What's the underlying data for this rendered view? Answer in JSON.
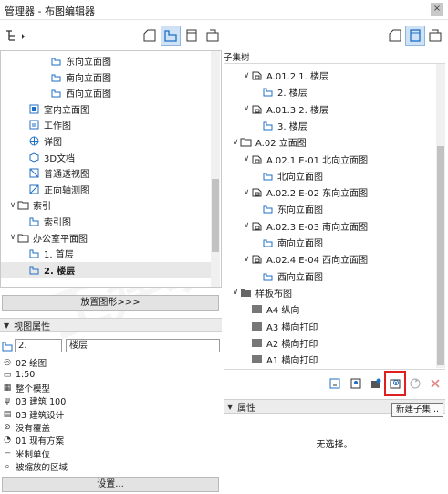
{
  "window": {
    "title": "管理器 - 布图编辑器",
    "close_glyph": "×"
  },
  "left_tree": [
    {
      "label": "东向立面图",
      "icon": "elevation-view-icon",
      "depth": 3,
      "chevron": ""
    },
    {
      "label": "南向立面图",
      "icon": "elevation-view-icon",
      "depth": 3,
      "chevron": ""
    },
    {
      "label": "西向立面图",
      "icon": "elevation-view-icon",
      "depth": 3,
      "chevron": ""
    },
    {
      "label": "室内立面图",
      "icon": "interior-elevation-icon",
      "depth": 1,
      "chevron": ""
    },
    {
      "label": "工作图",
      "icon": "worksheet-icon",
      "depth": 1,
      "chevron": ""
    },
    {
      "label": "详图",
      "icon": "detail-icon",
      "depth": 1,
      "chevron": ""
    },
    {
      "label": "3D文档",
      "icon": "3d-document-icon",
      "depth": 1,
      "chevron": ""
    },
    {
      "label": "普通透视图",
      "icon": "perspective-icon",
      "depth": 1,
      "chevron": ""
    },
    {
      "label": "正向轴测图",
      "icon": "axonometry-icon",
      "depth": 1,
      "chevron": ""
    },
    {
      "label": "索引",
      "icon": "folder-icon",
      "depth": 0,
      "chevron": "∨"
    },
    {
      "label": "索引图",
      "icon": "index-view-icon",
      "depth": 1,
      "chevron": ""
    },
    {
      "label": "办公室平面图",
      "icon": "folder-icon",
      "depth": 0,
      "chevron": "∨"
    },
    {
      "label": "1. 首层",
      "icon": "floor-plan-icon",
      "depth": 1,
      "chevron": ""
    },
    {
      "label": "2. 楼层",
      "icon": "floor-plan-icon",
      "depth": 1,
      "chevron": "",
      "selected": true
    }
  ],
  "place_button": "放置图形>>>",
  "view_props": {
    "header": "视图属性",
    "id_value": "2.",
    "name_value": "楼层",
    "rows": [
      {
        "icon": "layer-combination-icon",
        "glyph": "◎",
        "text": "02 绘图"
      },
      {
        "icon": "scale-icon",
        "glyph": "▭",
        "text": "1:50"
      },
      {
        "icon": "structure-display-icon",
        "glyph": "▦",
        "text": "整个模型"
      },
      {
        "icon": "pen-set-icon",
        "glyph": "ψ",
        "text": "03 建筑 100"
      },
      {
        "icon": "model-view-icon",
        "glyph": "▤",
        "text": "03 建筑设计"
      },
      {
        "icon": "override-icon",
        "glyph": "⊘",
        "text": "没有覆盖"
      },
      {
        "icon": "renovation-icon",
        "glyph": "◔",
        "text": "01 现有方案"
      },
      {
        "icon": "dimension-icon",
        "glyph": "⊢",
        "text": "米制单位"
      },
      {
        "icon": "zoom-area-icon",
        "glyph": "⌕",
        "text": "被缩放的区域"
      }
    ],
    "settings_button": "设置..."
  },
  "right_tree": {
    "header": "子集树",
    "items": [
      {
        "label": "A.01.2 1. 楼层",
        "icon": "subset-icon",
        "depth": 1,
        "chevron": "∨"
      },
      {
        "label": "2. 楼层",
        "icon": "floor-plan-icon",
        "depth": 2,
        "chevron": ""
      },
      {
        "label": "A.01.3 2. 楼层",
        "icon": "subset-icon",
        "depth": 1,
        "chevron": "∨"
      },
      {
        "label": "3. 楼层",
        "icon": "floor-plan-icon",
        "depth": 2,
        "chevron": ""
      },
      {
        "label": "A.02 立面图",
        "icon": "subset-folder-icon",
        "depth": 0,
        "chevron": "∨"
      },
      {
        "label": "A.02.1 E-01 北向立面图",
        "icon": "subset-icon",
        "depth": 1,
        "chevron": "∨"
      },
      {
        "label": "北向立面图",
        "icon": "elevation-view-icon",
        "depth": 2,
        "chevron": ""
      },
      {
        "label": "A.02.2 E-02 东向立面图",
        "icon": "subset-icon",
        "depth": 1,
        "chevron": "∨"
      },
      {
        "label": "东向立面图",
        "icon": "elevation-view-icon",
        "depth": 2,
        "chevron": ""
      },
      {
        "label": "A.02.3 E-03 南向立面图",
        "icon": "subset-icon",
        "depth": 1,
        "chevron": "∨"
      },
      {
        "label": "南向立面图",
        "icon": "elevation-view-icon",
        "depth": 2,
        "chevron": ""
      },
      {
        "label": "A.02.4 E-04 西向立面图",
        "icon": "subset-icon",
        "depth": 1,
        "chevron": "∨"
      },
      {
        "label": "西向立面图",
        "icon": "elevation-view-icon",
        "depth": 2,
        "chevron": ""
      },
      {
        "label": "样板布图",
        "icon": "master-folder-icon",
        "depth": 0,
        "chevron": "∨"
      },
      {
        "label": "A4 纵向",
        "icon": "master-layout-icon",
        "depth": 1,
        "chevron": ""
      },
      {
        "label": "A3 横向打印",
        "icon": "master-layout-icon",
        "depth": 1,
        "chevron": ""
      },
      {
        "label": "A2 横向打印",
        "icon": "master-layout-icon",
        "depth": 1,
        "chevron": ""
      },
      {
        "label": "A1 横向打印",
        "icon": "master-layout-icon",
        "depth": 1,
        "chevron": ""
      }
    ]
  },
  "properties": {
    "header": "属性",
    "empty_text": "无选择。"
  },
  "tooltip": "新建子集...",
  "colors": {
    "accent": "#1f6fc6",
    "highlight": "#e02020",
    "selection": "#cfe1f5"
  }
}
